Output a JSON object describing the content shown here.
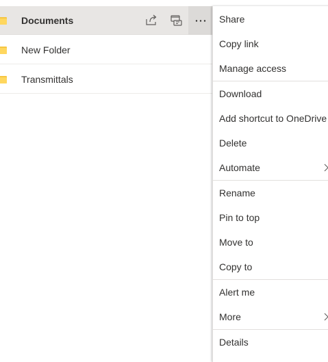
{
  "files": [
    {
      "name": "Documents",
      "selected": true
    },
    {
      "name": "New Folder",
      "selected": false
    },
    {
      "name": "Transmittals",
      "selected": false
    }
  ],
  "row_actions": {
    "share_icon": "share-icon",
    "teams_icon": "open-in-teams-icon",
    "more_icon": "more-ellipsis-icon"
  },
  "context_menu": {
    "items": [
      {
        "label": "Share"
      },
      {
        "label": "Copy link"
      },
      {
        "label": "Manage access"
      },
      {
        "label": "Download"
      },
      {
        "label": "Add shortcut to OneDrive"
      },
      {
        "label": "Delete"
      },
      {
        "label": "Automate",
        "has_submenu": true
      },
      {
        "label": "Rename"
      },
      {
        "label": "Pin to top"
      },
      {
        "label": "Move to"
      },
      {
        "label": "Copy to"
      },
      {
        "label": "Alert me"
      },
      {
        "label": "More",
        "has_submenu": true
      },
      {
        "label": "Details"
      }
    ]
  },
  "colors": {
    "folder": "#ffd75e",
    "selected_row": "#e8e6e4",
    "text": "#323130",
    "divider": "#e1dfdd"
  }
}
